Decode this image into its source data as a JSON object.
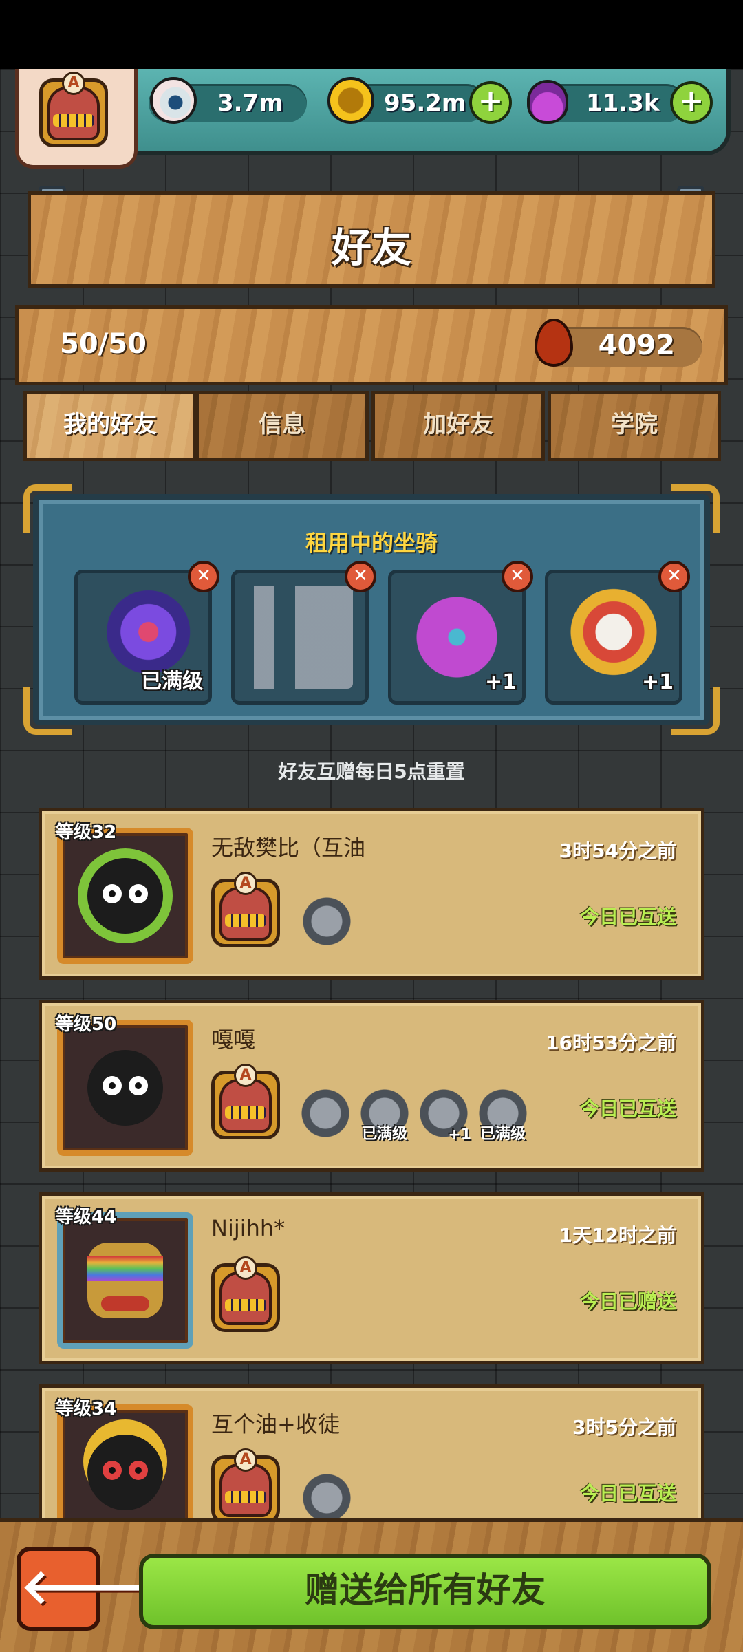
{
  "resources": {
    "eyes": "3.7m",
    "coins": "95.2m",
    "potions": "11.3k",
    "plus": "+"
  },
  "player_badge_letter": "A",
  "page_title": "好友",
  "friend_count": "50/50",
  "blood_points": "4092",
  "tabs": [
    "我的好友",
    "信息",
    "加好友",
    "学院"
  ],
  "mounts": {
    "title": "租用中的坐骑",
    "close": "✕",
    "slots": [
      {
        "icon": "rose-mount",
        "tag": "已满级"
      },
      {
        "icon": "machine-mount",
        "tag": ""
      },
      {
        "icon": "demon-mount",
        "tag": "+1"
      },
      {
        "icon": "lion-dance-mount",
        "tag": "+1"
      }
    ]
  },
  "notice": "好友互赠每日5点重置",
  "friends": [
    {
      "level": "等级32",
      "name": "无敌樊比（互油",
      "time": "3时54分之前",
      "status": "今日已互送",
      "mounts": [
        ""
      ]
    },
    {
      "level": "等级50",
      "name": "嘎嘎",
      "time": "16时53分之前",
      "status": "今日已互送",
      "mounts": [
        "",
        "已满级",
        "+1",
        "已满级"
      ]
    },
    {
      "level": "等级44",
      "name": "Nijihh*",
      "time": "1天12时之前",
      "status": "今日已赠送",
      "mounts": []
    },
    {
      "level": "等级34",
      "name": "互个油+收徒",
      "time": "3时5分之前",
      "status": "今日已互送",
      "mounts": [
        ""
      ]
    }
  ],
  "bottom": {
    "back_icon": "🡐",
    "send_all_label": "赠送给所有好友"
  },
  "colors": {
    "accent_green": "#8fd33d",
    "status_green": "#b9ee52",
    "wood": "#c98f4e",
    "panel_blue": "#3b6f86"
  }
}
